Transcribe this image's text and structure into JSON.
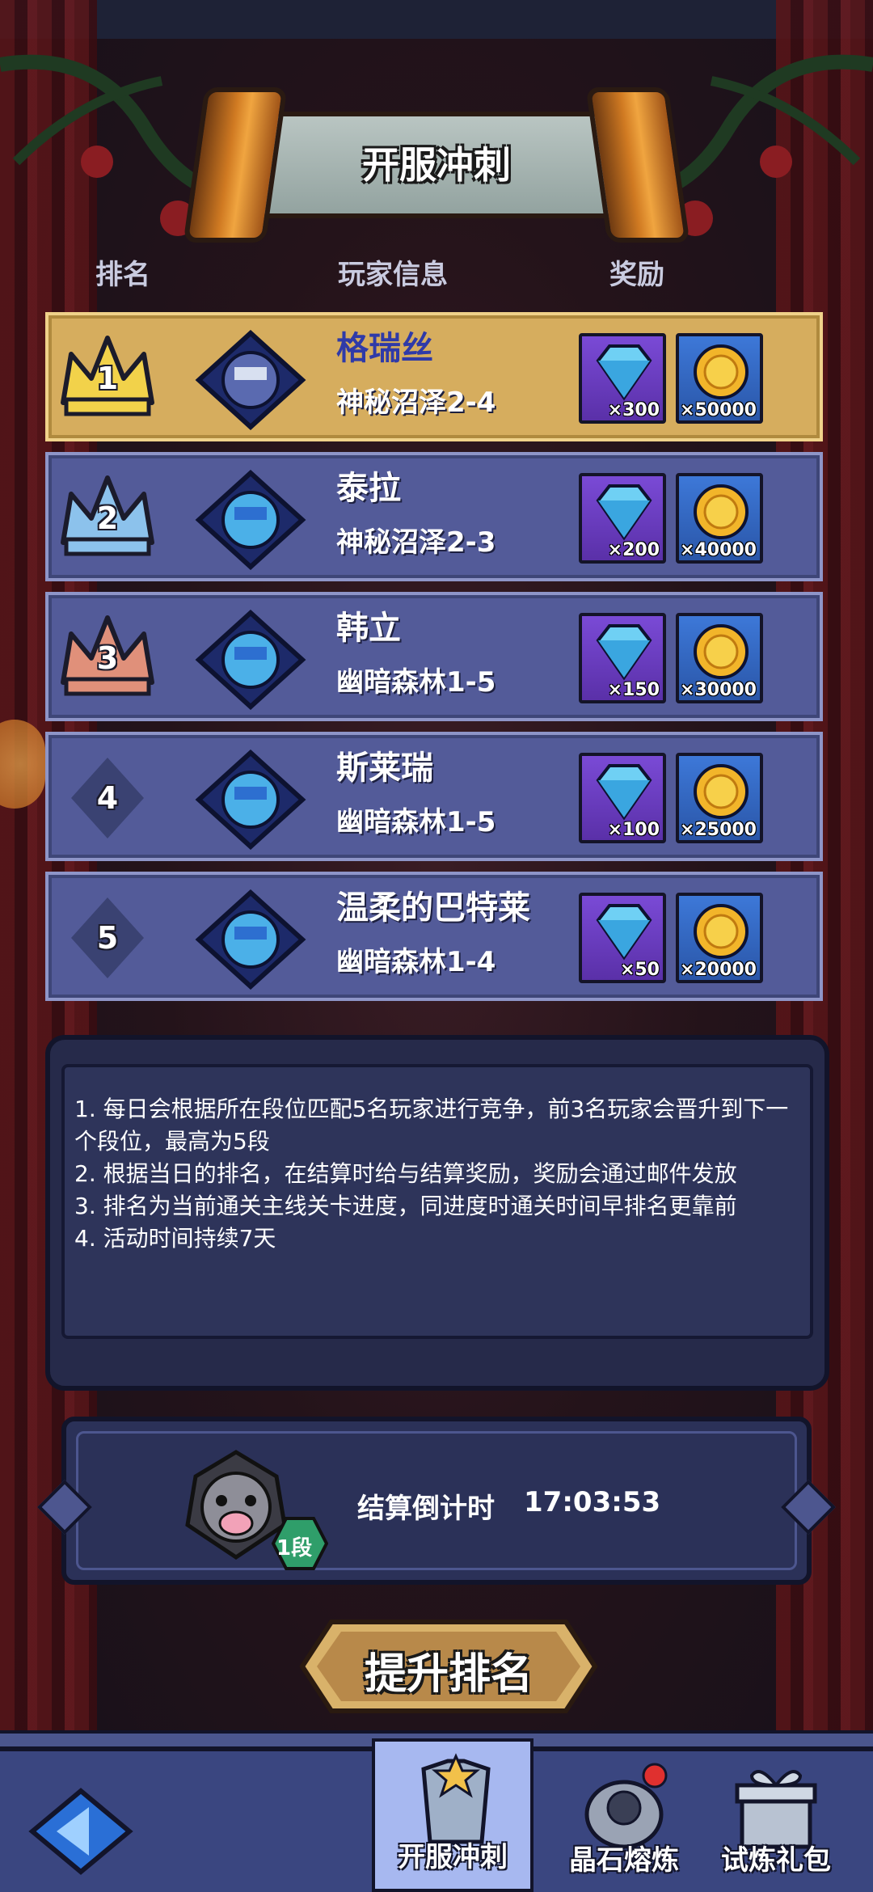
{
  "header": {
    "title": "开服冲刺"
  },
  "columns": {
    "rank": "排名",
    "player_info": "玩家信息",
    "reward": "奖励"
  },
  "rankings": [
    {
      "rank": "1",
      "name": "格瑞丝",
      "level": "神秘沼泽2-4",
      "gems": "×300",
      "coins": "×50000",
      "badge": "gold-crown-icon"
    },
    {
      "rank": "2",
      "name": "泰拉",
      "level": "神秘沼泽2-3",
      "gems": "×200",
      "coins": "×40000",
      "badge": "silver-crown-icon"
    },
    {
      "rank": "3",
      "name": "韩立",
      "level": "幽暗森林1-5",
      "gems": "×150",
      "coins": "×30000",
      "badge": "bronze-crown-icon"
    },
    {
      "rank": "4",
      "name": "斯莱瑞",
      "level": "幽暗森林1-5",
      "gems": "×100",
      "coins": "×25000",
      "badge": "diamond-rank-icon"
    },
    {
      "rank": "5",
      "name": "温柔的巴特莱",
      "level": "幽暗森林1-4",
      "gems": "×50",
      "coins": "×20000",
      "badge": "diamond-rank-icon"
    }
  ],
  "rules": [
    "1. 每日会根据所在段位匹配5名玩家进行竞争，前3名玩家会晋升到下一",
    "个段位，最高为5段",
    "2. 根据当日的排名，在结算时给与结算奖励，奖励会通过邮件发放",
    "3. 排名为当前通关主线关卡进度，同进度时通关时间早排名更靠前",
    "4. 活动时间持续7天"
  ],
  "countdown": {
    "label": "结算倒计时",
    "time": "17:03:53",
    "segment": "1段"
  },
  "action_button": {
    "label": "提升排名"
  },
  "nav": {
    "tabs": [
      "开服冲刺",
      "晶石熔炼",
      "试炼礼包"
    ],
    "active": "开服冲刺"
  },
  "colors": {
    "row": "#535b99",
    "row_first": "#d6ad5e",
    "gem": "#7a4ad6",
    "coin": "#3d78d8",
    "gold": "#e0a32a"
  }
}
